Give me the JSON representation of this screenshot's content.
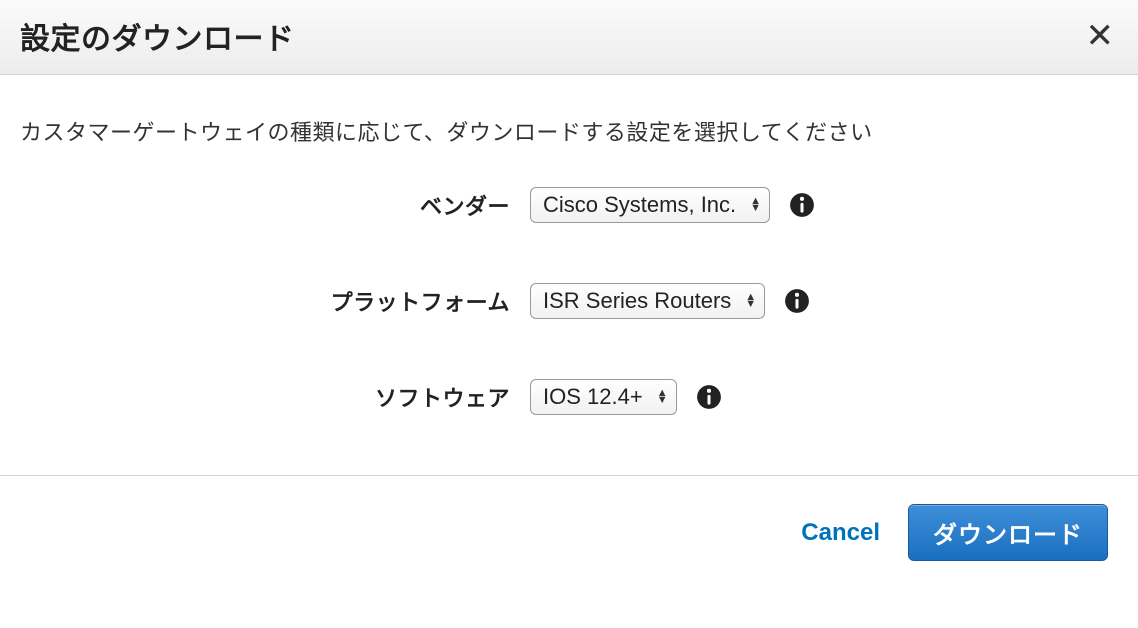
{
  "header": {
    "title": "設定のダウンロード"
  },
  "body": {
    "instruction": "カスタマーゲートウェイの種類に応じて、ダウンロードする設定を選択してください",
    "fields": {
      "vendor": {
        "label": "ベンダー",
        "value": "Cisco Systems, Inc."
      },
      "platform": {
        "label": "プラットフォーム",
        "value": "ISR Series Routers"
      },
      "software": {
        "label": "ソフトウェア",
        "value": "IOS 12.4+"
      }
    }
  },
  "footer": {
    "cancel": "Cancel",
    "download": "ダウンロード"
  }
}
